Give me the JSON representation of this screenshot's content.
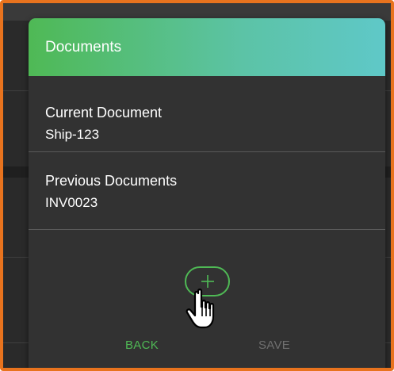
{
  "modal": {
    "title": "Documents"
  },
  "current_document": {
    "label": "Current Document",
    "value": "Ship-123"
  },
  "previous_documents": {
    "label": "Previous Documents",
    "value": "INV0023"
  },
  "actions": {
    "add_icon": "plus-icon",
    "back_label": "BACK",
    "save_label": "SAVE"
  },
  "colors": {
    "accent": "#4fb955",
    "header_gradient_end": "#5fc8c8",
    "frame_border": "#e8731e",
    "disabled_text": "#6f6f6f"
  }
}
